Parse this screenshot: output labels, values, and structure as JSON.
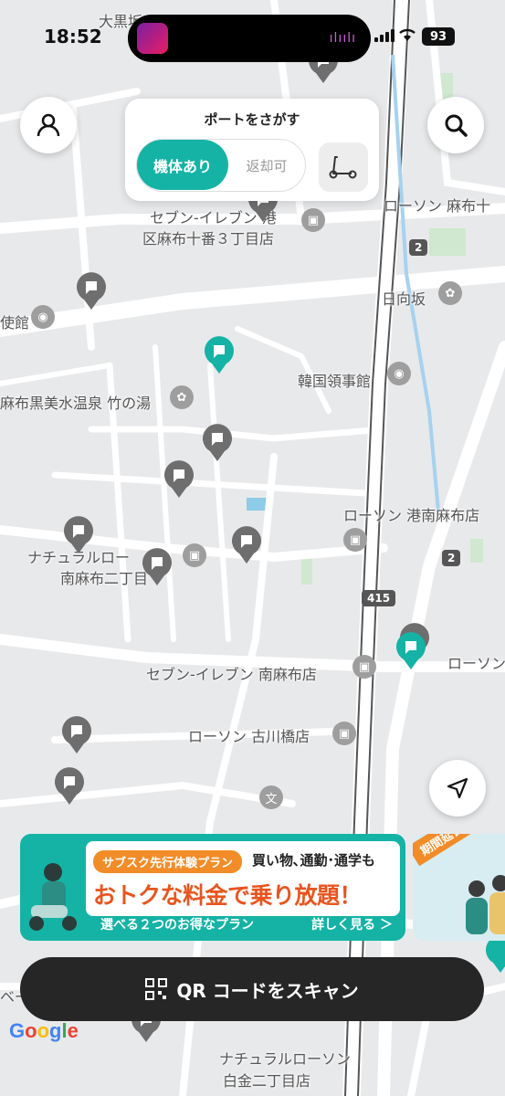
{
  "status_bar": {
    "time": "18:52",
    "battery": "93"
  },
  "map": {
    "labels": {
      "oguro": "大黒坂",
      "seven_azabu_1": "セブン-イレブン 港",
      "seven_azabu_2": "区麻布十番３丁目店",
      "lawson_azabu": "ローソン 麻布十",
      "hyugazaka": "日向坂",
      "embassy_left": "使館",
      "korea_consulate": "韓国領事館",
      "onsen": "麻布黒美水温泉 竹の湯",
      "lawson_minami": "ローソン 港南麻布店",
      "natural_1": "ナチュラルロー",
      "natural_2": "南麻布二丁目",
      "seven_minami": "セブン-イレブン 南麻布店",
      "lawson_right": "ローソン",
      "lawson_furukawa": "ローソン 古川橋店",
      "natural_bottom_1": "ナチュラルローソン",
      "natural_bottom_2": "白金二丁目店",
      "be_fragment": "ベー",
      "road_415": "415",
      "road_2a": "2",
      "road_2b": "2",
      "bun_icon": "文"
    }
  },
  "controls": {
    "port_title": "ポートをさがす",
    "seg_available": "機体あり",
    "seg_return": "返却可"
  },
  "banner": {
    "tag": "サブスク先行体験プラン",
    "subtitle": "買い物､通勤･通学も",
    "headline": "おトクな料金で乗り放題！",
    "footer": "選べる２つのお得なプラン",
    "more": "詳しく見る ＞"
  },
  "banner2": {
    "tag": "期間延長"
  },
  "scan_button": {
    "label": "QR コードをスキャン"
  },
  "attribution": {
    "google": "Google"
  },
  "colors": {
    "accent": "#14b3a5",
    "pin_gray": "#6e6e6e",
    "banner_orange": "#e8551f"
  }
}
